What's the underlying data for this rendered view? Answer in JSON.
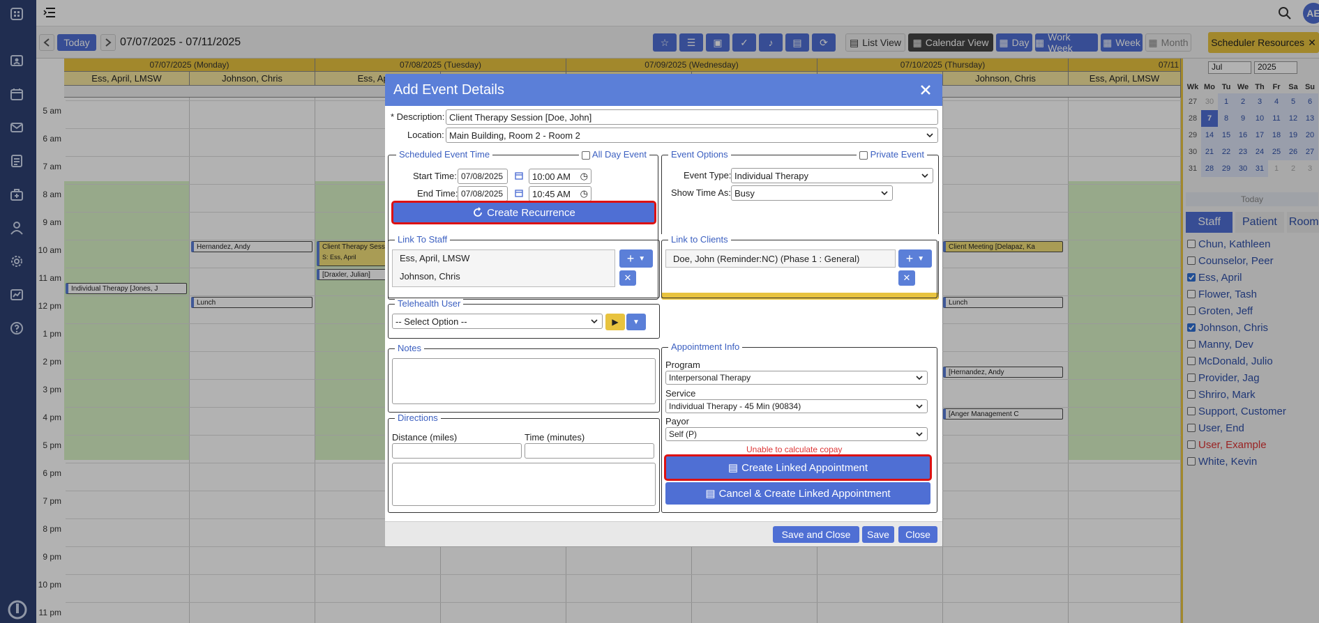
{
  "topbar": {
    "avatar_initials": "AE"
  },
  "toolbar": {
    "today_label": "Today",
    "date_range": "07/07/2025 - 07/11/2025",
    "list_view": "List View",
    "calendar_view": "Calendar View",
    "day": "Day",
    "work_week": "Work Week",
    "week": "Week",
    "month": "Month",
    "scheduler_resources": "Scheduler Resources"
  },
  "calendar": {
    "days": [
      {
        "label": "07/07/2025 (Monday)"
      },
      {
        "label": "07/08/2025 (Tuesday)"
      },
      {
        "label": "07/09/2025 (Wednesday)"
      },
      {
        "label": "07/10/2025 (Thursday)"
      },
      {
        "label": "07/11"
      }
    ],
    "staff_headers": [
      "Ess, April, LMSW",
      "Johnson, Chris",
      "Ess, April,",
      "Johnson, Chris",
      "Ess, April, LMSW"
    ],
    "hours": [
      "5 am",
      "6 am",
      "7 am",
      "8 am",
      "9 am",
      "10 am",
      "11 am",
      "12 pm",
      "1 pm",
      "2 pm",
      "3 pm",
      "4 pm",
      "5 pm",
      "6 pm",
      "7 pm",
      "8 pm",
      "9 pm",
      "10 pm",
      "11 pm"
    ],
    "events": {
      "hernandez_mon": "Hernandez, Andy",
      "individual_therapy": "Individual Therapy [Jones, J",
      "lunch_mon": "Lunch",
      "client_therapy": "Client Therapy Sessi",
      "client_therapy_sub": "S: Ess, April",
      "draxler": "[Draxler, Julian]",
      "client_meeting": "Client Meeting [Delapaz, Ka",
      "lunch_thu": "Lunch",
      "hernandez_thu": "[Hernandez, Andy",
      "anger": "[Anger Management C"
    }
  },
  "minical": {
    "month": "Jul",
    "year": "2025",
    "weekday_headers": [
      "Wk",
      "Mo",
      "Tu",
      "We",
      "Th",
      "Fr",
      "Sa",
      "Su"
    ],
    "rows": [
      [
        "27",
        "30",
        "1",
        "2",
        "3",
        "4",
        "5",
        "6"
      ],
      [
        "28",
        "7",
        "8",
        "9",
        "10",
        "11",
        "12",
        "13"
      ],
      [
        "29",
        "14",
        "15",
        "16",
        "17",
        "18",
        "19",
        "20"
      ],
      [
        "30",
        "21",
        "22",
        "23",
        "24",
        "25",
        "26",
        "27"
      ],
      [
        "31",
        "28",
        "29",
        "30",
        "31",
        "1",
        "2",
        "3"
      ]
    ],
    "today_label": "Today"
  },
  "resources": {
    "tabs": [
      "Staff",
      "Patient",
      "Room"
    ],
    "staff": [
      {
        "name": "Chun, Kathleen",
        "checked": false
      },
      {
        "name": "Counselor, Peer",
        "checked": false
      },
      {
        "name": "Ess, April",
        "checked": true
      },
      {
        "name": "Flower, Tash",
        "checked": false
      },
      {
        "name": "Groten, Jeff",
        "checked": false
      },
      {
        "name": "Johnson, Chris",
        "checked": true
      },
      {
        "name": "Manny, Dev",
        "checked": false
      },
      {
        "name": "McDonald, Julio",
        "checked": false
      },
      {
        "name": "Provider, Jag",
        "checked": false
      },
      {
        "name": "Shriro, Mark",
        "checked": false
      },
      {
        "name": "Support, Customer",
        "checked": false
      },
      {
        "name": "User, End",
        "checked": false
      },
      {
        "name": "User, Example",
        "checked": false
      },
      {
        "name": "White, Kevin",
        "checked": false
      }
    ]
  },
  "modal": {
    "title": "Add Event Details",
    "description_label": "* Description:",
    "description_value": "Client Therapy Session [Doe, John]",
    "location_label": "Location:",
    "location_value": "Main Building, Room 2 - Room 2",
    "scheduled_legend": "Scheduled Event Time",
    "all_day_label": "All Day Event",
    "start_label": "Start Time:",
    "start_date": "07/08/2025",
    "start_time": "10:00 AM",
    "end_label": "End Time:",
    "end_date": "07/08/2025",
    "end_time": "10:45 AM",
    "create_recurrence": "Create Recurrence",
    "event_options_legend": "Event Options",
    "private_label": "Private Event",
    "event_type_label": "Event Type:",
    "event_type_value": "Individual Therapy",
    "show_time_label": "Show Time As:",
    "show_time_value": "Busy",
    "link_staff_legend": "Link To Staff",
    "staff": [
      "Ess, April, LMSW",
      "Johnson, Chris"
    ],
    "link_clients_legend": "Link to Clients",
    "client": "Doe, John (Reminder:NC) (Phase 1 : General)",
    "telehealth_legend": "Telehealth User",
    "telehealth_value": "-- Select Option --",
    "notes_legend": "Notes",
    "directions_legend": "Directions",
    "distance_label": "Distance (miles)",
    "time_label": "Time (minutes)",
    "appointment_legend": "Appointment Info",
    "program_label": "Program",
    "program_value": "Interpersonal Therapy",
    "service_label": "Service",
    "service_value": "Individual Therapy - 45 Min (90834)",
    "payor_label": "Payor",
    "payor_value": "Self (P)",
    "copay_msg": "Unable to calculate copay",
    "create_linked": "Create Linked Appointment",
    "cancel_create_linked": "Cancel & Create Linked Appointment",
    "save_close": "Save and Close",
    "save": "Save",
    "close": "Close"
  },
  "colors": {
    "primary": "#5b7fd8",
    "sidebar": "#2e4173",
    "highlight": "#d11111",
    "accent_yellow": "#e8c33f"
  }
}
